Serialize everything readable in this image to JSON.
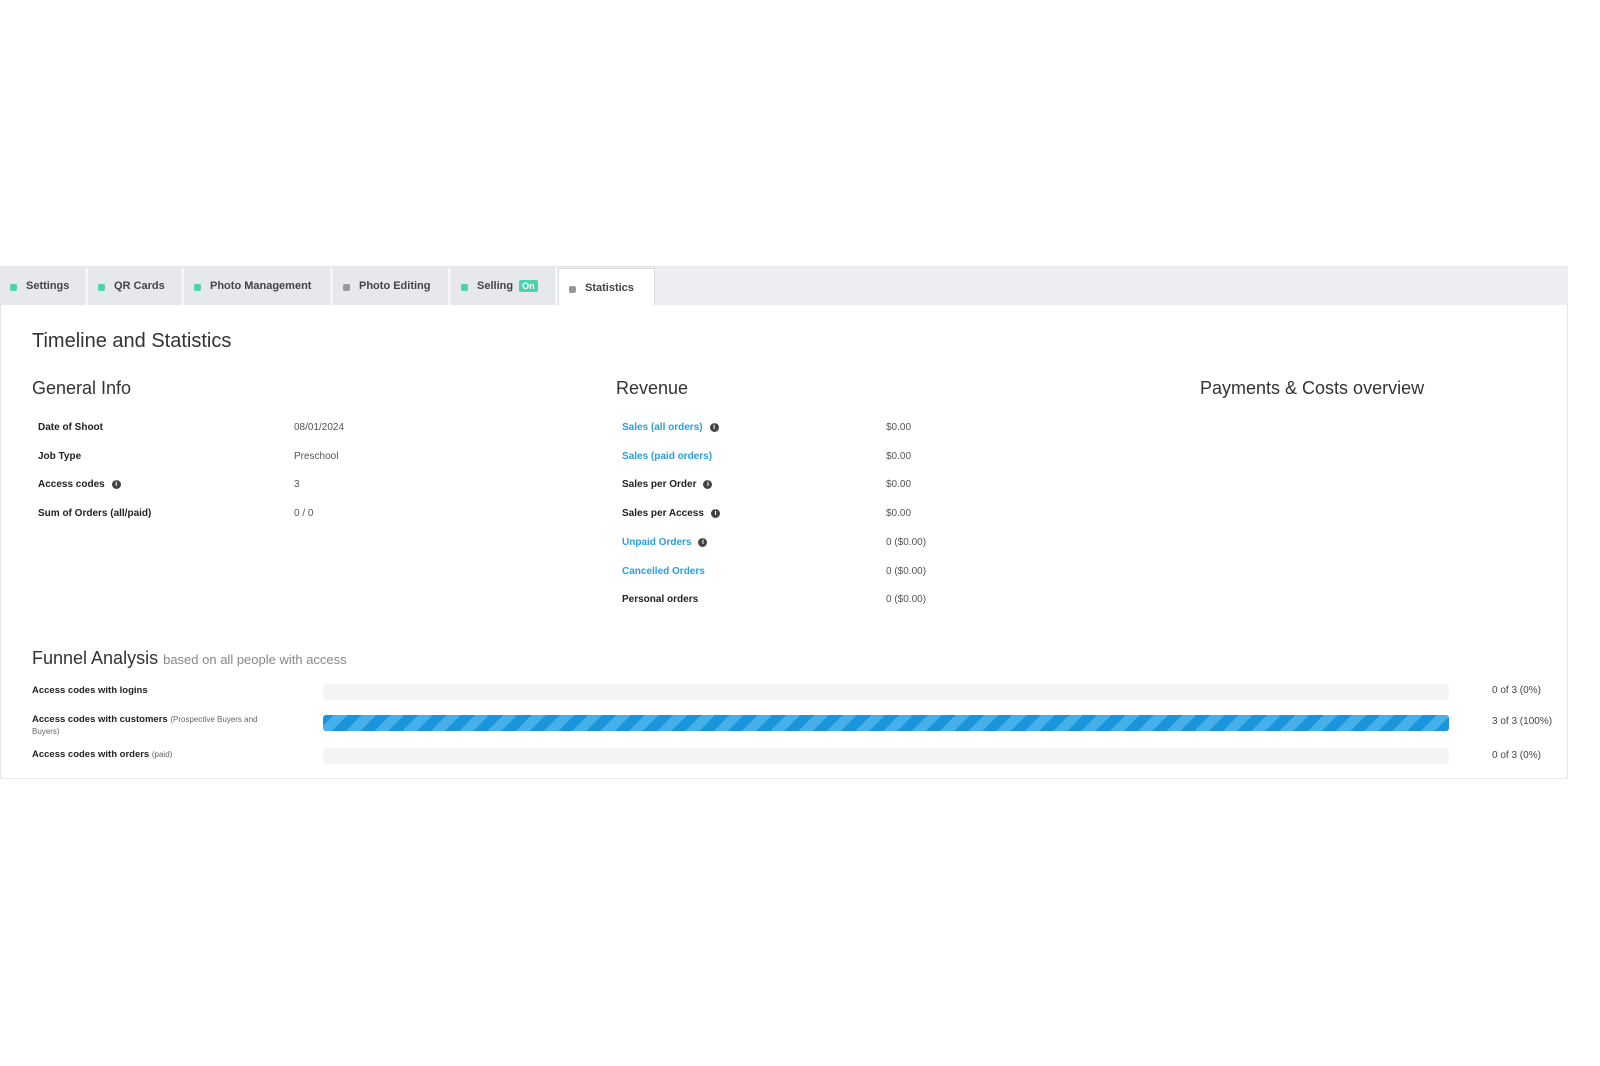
{
  "tabs": [
    {
      "label": "Settings",
      "status_color": "#4fd1b0"
    },
    {
      "label": "QR Cards",
      "status_color": "#4fd1b0"
    },
    {
      "label": "Photo Management",
      "status_color": "#4fd1b0"
    },
    {
      "label": "Photo Editing",
      "status_color": "#999999"
    },
    {
      "label": "Selling",
      "status_color": "#4fd1b0",
      "badge": "On"
    },
    {
      "label": "Statistics",
      "status_color": "#999999",
      "active": true
    }
  ],
  "title": "Timeline and Statistics",
  "general": {
    "heading": "General Info",
    "rows": [
      {
        "label": "Date of Shoot",
        "value": "08/01/2024"
      },
      {
        "label": "Job Type",
        "value": "Preschool"
      },
      {
        "label": "Access codes",
        "value": "3",
        "info": true
      },
      {
        "label": "Sum of Orders (all/paid)",
        "value": "0 / 0"
      }
    ]
  },
  "revenue": {
    "heading": "Revenue",
    "rows": [
      {
        "label": "Sales (all orders)",
        "value": "$0.00",
        "link": true,
        "info": true
      },
      {
        "label": "Sales (paid orders)",
        "value": "$0.00",
        "link": true
      },
      {
        "label": "Sales per Order",
        "value": "$0.00",
        "info": true
      },
      {
        "label": "Sales per Access",
        "value": "$0.00",
        "info": true
      },
      {
        "label": "Unpaid Orders",
        "value": "0 ($0.00)",
        "link": true,
        "info": true
      },
      {
        "label": "Cancelled Orders",
        "value": "0 ($0.00)",
        "link": true
      },
      {
        "label": "Personal orders",
        "value": "0 ($0.00)"
      }
    ]
  },
  "payments": {
    "heading": "Payments & Costs overview"
  },
  "funnel": {
    "heading": "Funnel Analysis",
    "subheading": "based on all people with access",
    "rows": [
      {
        "label": "Access codes with logins",
        "note": "",
        "value": "0 of 3 (0%)",
        "fraction": 0
      },
      {
        "label": "Access codes with customers",
        "note": "(Prospective Buyers and Buyers)",
        "value": "3 of 3 (100%)",
        "fraction": 1
      },
      {
        "label": "Access codes with orders",
        "note": "(paid)",
        "value": "0 of 3 (0%)",
        "fraction": 0
      }
    ]
  },
  "accent": "#1a95dc"
}
